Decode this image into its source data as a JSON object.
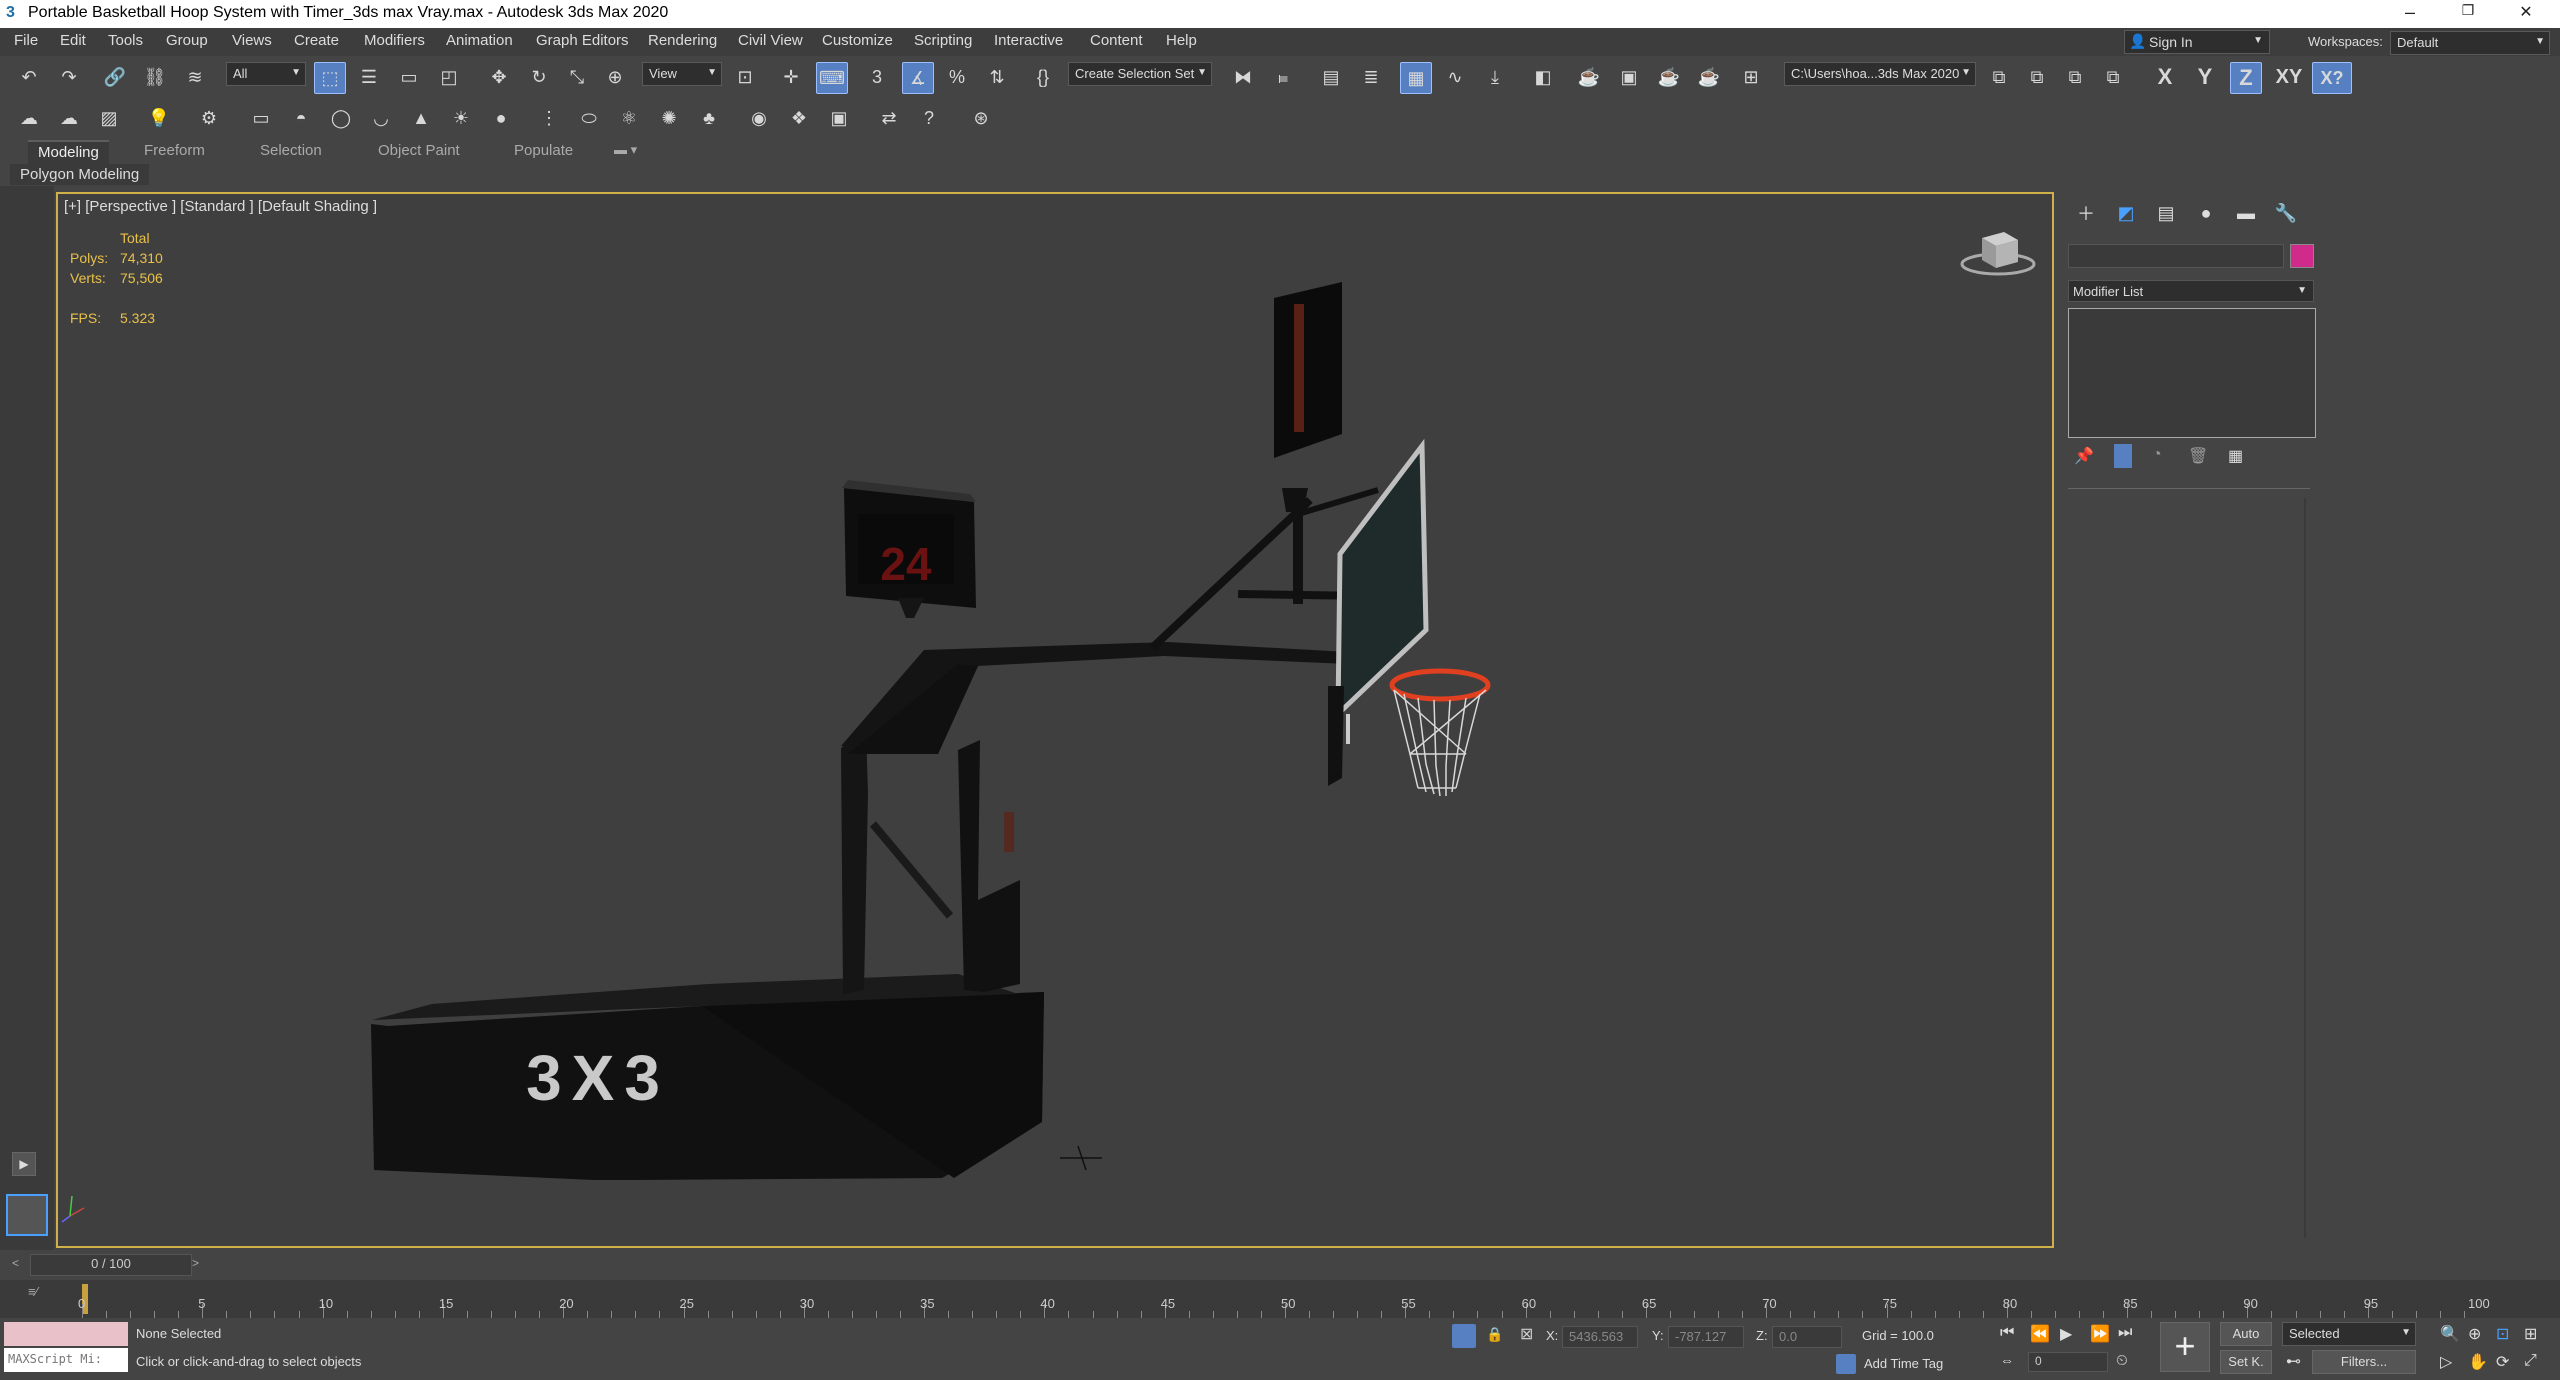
{
  "window": {
    "title": "Portable Basketball Hoop System with Timer_3ds max Vray.max - Autodesk 3ds Max 2020",
    "minimize": "–",
    "restore": "❐",
    "close": "✕"
  },
  "menu": [
    "File",
    "Edit",
    "Tools",
    "Group",
    "Views",
    "Create",
    "Modifiers",
    "Animation",
    "Graph Editors",
    "Rendering",
    "Civil View",
    "Customize",
    "Scripting",
    "Interactive",
    "Content",
    "Help"
  ],
  "account": {
    "sign_in": "Sign In",
    "workspaces_label": "Workspaces:",
    "workspace": "Default"
  },
  "toolbar": {
    "selection_filter": "All",
    "ref_coord": "View",
    "named_selection": "Create Selection Set",
    "project_path": "C:\\Users\\hoa...3ds Max 2020",
    "axis_x": "X",
    "axis_y": "Y",
    "axis_z": "Z",
    "axis_xy": "XY"
  },
  "ribbon": {
    "tabs": [
      "Modeling",
      "Freeform",
      "Selection",
      "Object Paint",
      "Populate"
    ],
    "sub": "Polygon Modeling"
  },
  "viewport": {
    "label": "[+] [Perspective ] [Standard ] [Default Shading ]",
    "stats": {
      "total_label": "Total",
      "polys_label": "Polys:",
      "polys": "74,310",
      "verts_label": "Verts:",
      "verts": "75,506",
      "fps_label": "FPS:",
      "fps": "5.323"
    },
    "model_text": "3X3",
    "shot_clock": "24"
  },
  "command_panel": {
    "modifier_list": "Modifier List",
    "swatch_color": "#d02a8a"
  },
  "timeline": {
    "frame": "0 / 100",
    "ticks": [
      "0",
      "5",
      "10",
      "15",
      "20",
      "25",
      "30",
      "35",
      "40",
      "45",
      "50",
      "55",
      "60",
      "65",
      "70",
      "75",
      "80",
      "85",
      "90",
      "95",
      "100"
    ]
  },
  "status": {
    "maxscript": "MAXScript Mi:",
    "selection": "None Selected",
    "prompt": "Click or click-and-drag to select objects",
    "x_label": "X:",
    "x": "5436.563",
    "y_label": "Y:",
    "y": "-787.127",
    "z_label": "Z:",
    "z": "0.0",
    "grid": "Grid = 100.0",
    "add_time_tag": "Add Time Tag",
    "auto": "Auto",
    "set_key": "Set K.",
    "key_filter": "Selected",
    "filters": "Filters...",
    "frame_value": "0"
  }
}
